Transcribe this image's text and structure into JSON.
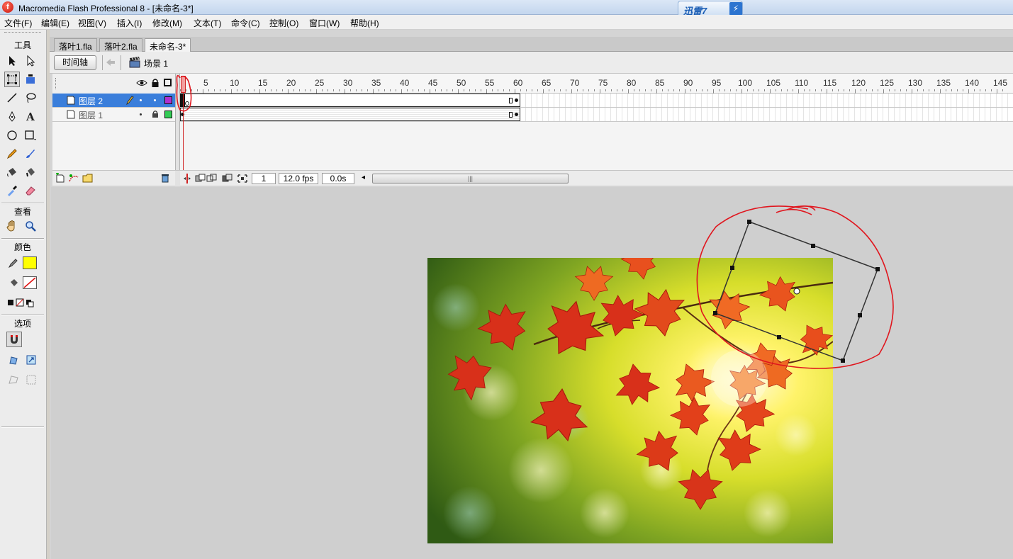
{
  "app": {
    "title": "Macromedia Flash Professional 8 - [未命名-3*]",
    "logo_glyph": "f",
    "xunlei_badge": "迅雷7",
    "xunlei_bolt": "⚡"
  },
  "menu": [
    "文件(F)",
    "编辑(E)",
    "视图(V)",
    "插入(I)",
    "修改(M)",
    "文本(T)",
    "命令(C)",
    "控制(O)",
    "窗口(W)",
    "帮助(H)"
  ],
  "tools": {
    "section_tools": "工具",
    "section_view": "查看",
    "section_colors": "颜色",
    "section_options": "选项",
    "stroke_color": "#ffff00"
  },
  "doc_tabs": [
    "落叶1.fla",
    "落叶2.fla",
    "未命名-3*"
  ],
  "editbar": {
    "timeline_button": "时间轴",
    "scene": "场景 1"
  },
  "timeline": {
    "ruler_labels": [
      "5",
      "10",
      "15",
      "20",
      "25",
      "30",
      "35",
      "40",
      "45",
      "50",
      "55",
      "60",
      "65",
      "70",
      "75",
      "80",
      "85",
      "90",
      "95",
      "100",
      "105",
      "110",
      "115",
      "120",
      "125",
      "130",
      "135",
      "140",
      "145"
    ],
    "layers": [
      {
        "name": "图层 2",
        "selected": true,
        "color": "#b030d0",
        "frames": 60
      },
      {
        "name": "图层 1",
        "selected": false,
        "color": "#33cc55",
        "frames": 60
      }
    ],
    "current_frame": "1",
    "fps": "12.0 fps",
    "elapsed": "0.0s",
    "scroll_grip": "|||"
  },
  "colors": {
    "annotation_red": "#e0161e",
    "selected_layer": "#3a7edb"
  }
}
